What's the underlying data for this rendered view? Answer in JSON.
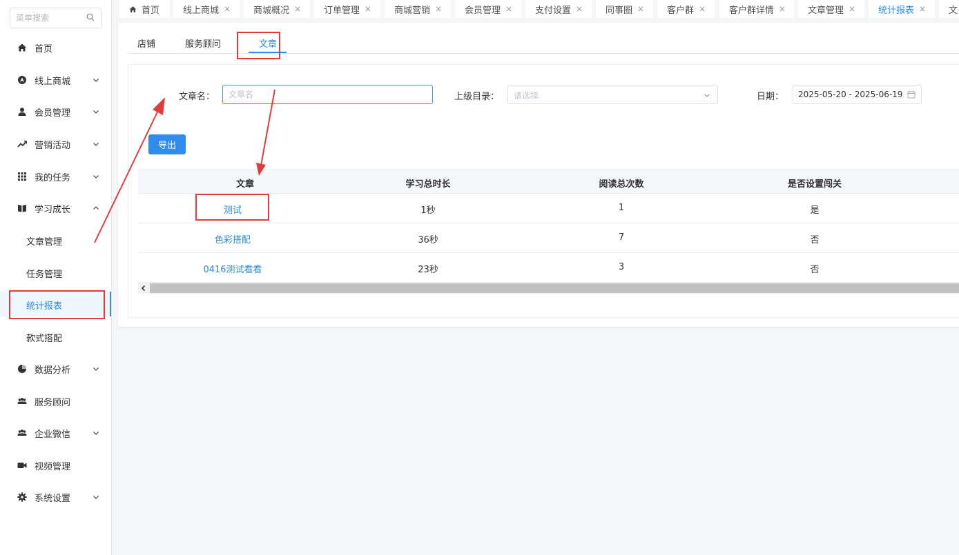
{
  "sidebar": {
    "search_placeholder": "菜单搜索",
    "items": [
      {
        "label": "首页"
      },
      {
        "label": "线上商城"
      },
      {
        "label": "会员管理"
      },
      {
        "label": "营销活动"
      },
      {
        "label": "我的任务"
      },
      {
        "label": "学习成长"
      },
      {
        "label": "文章管理"
      },
      {
        "label": "任务管理"
      },
      {
        "label": "统计报表"
      },
      {
        "label": "款式搭配"
      },
      {
        "label": "数据分析"
      },
      {
        "label": "服务顾问"
      },
      {
        "label": "企业微信"
      },
      {
        "label": "视频管理"
      },
      {
        "label": "系统设置"
      }
    ]
  },
  "tabs": [
    {
      "label": "首页"
    },
    {
      "label": "线上商城",
      "close": "×"
    },
    {
      "label": "商城概况",
      "close": "×"
    },
    {
      "label": "订单管理",
      "close": "×"
    },
    {
      "label": "商城营销",
      "close": "×"
    },
    {
      "label": "会员管理",
      "close": "×"
    },
    {
      "label": "支付设置",
      "close": "×"
    },
    {
      "label": "同事圈",
      "close": "×"
    },
    {
      "label": "客户群",
      "close": "×"
    },
    {
      "label": "客户群详情",
      "close": "×"
    },
    {
      "label": "文章管理",
      "close": "×"
    },
    {
      "label": "统计报表",
      "close": "×"
    },
    {
      "label": "文"
    }
  ],
  "subtabs": [
    {
      "label": "店铺"
    },
    {
      "label": "服务顾问"
    },
    {
      "label": "文章"
    }
  ],
  "filters": {
    "article_name_label": "文章名：",
    "article_name_placeholder": "文章名",
    "parent_dir_label": "上级目录：",
    "parent_dir_placeholder": "请选择",
    "date_label": "日期：",
    "date_value": "2025-05-20 - 2025-06-19"
  },
  "export_label": "导出",
  "table": {
    "headers": [
      "文章",
      "学习总时长",
      "阅读总次数",
      "是否设置闯关"
    ],
    "rows": [
      [
        "测试",
        "1秒",
        "1",
        "是"
      ],
      [
        "色彩搭配",
        "36秒",
        "7",
        "否"
      ],
      [
        "0416测试看看",
        "23秒",
        "3",
        "否"
      ]
    ]
  },
  "colors": {
    "accent": "#2d8cf0",
    "link": "#2a8dd4",
    "annotation": "#e03c3c"
  }
}
